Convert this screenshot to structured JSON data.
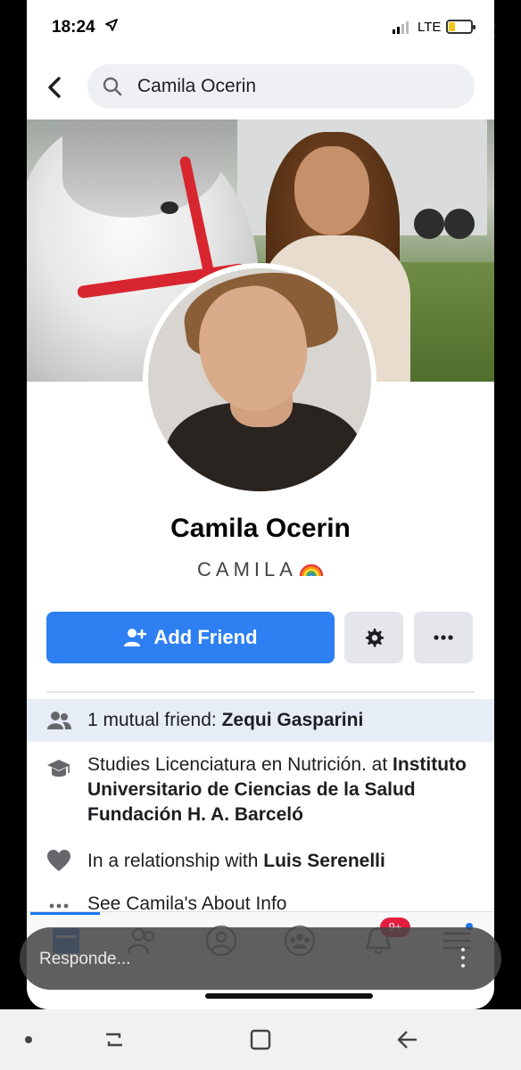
{
  "status_bar": {
    "time": "18:24",
    "network": "LTE",
    "battery_level": 0.3
  },
  "search": {
    "query": "Camila Ocerin"
  },
  "profile": {
    "name": "Camila Ocerin",
    "nickname": "CAMILA",
    "actions": {
      "add_friend_label": "Add Friend"
    }
  },
  "intro": {
    "mutual": {
      "prefix": "1 mutual friend: ",
      "name": "Zequi Gasparini"
    },
    "education": {
      "prefix": "Studies Licenciatura en Nutrición. at ",
      "school": "Instituto Universitario de Ciencias de la Salud Fundación H. A. Barceló"
    },
    "relationship": {
      "prefix": "In a relationship with ",
      "partner": "Luis Serenelli"
    },
    "about_link": "See Camila's About Info"
  },
  "tabbar": {
    "notification_badge": "9+",
    "tabs": [
      "home-icon",
      "friends-icon",
      "profile-icon",
      "groups-icon",
      "notifications-icon",
      "menu-icon"
    ]
  },
  "reply": {
    "placeholder": "Responde..."
  }
}
